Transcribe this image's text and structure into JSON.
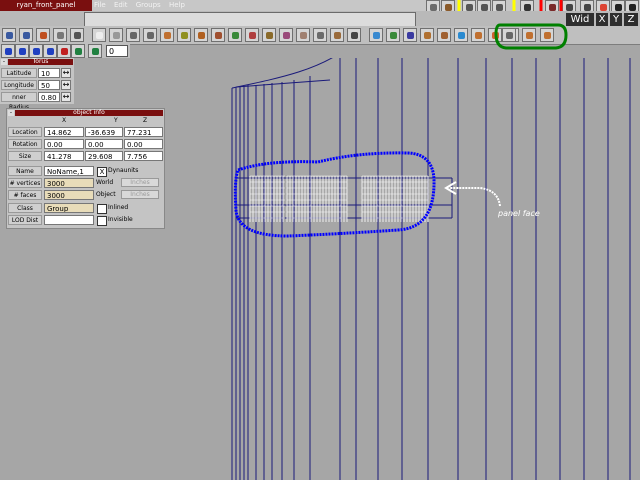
{
  "window": {
    "title": "ryan_front_panel"
  },
  "menu": [
    "File",
    "Edit",
    "Groups",
    "Help"
  ],
  "view_controls": {
    "wid": "Wid",
    "x": "X",
    "y": "Y",
    "z": "Z"
  },
  "timeline": {
    "frame": "0"
  },
  "torus_panel": {
    "title": "Torus",
    "fields": [
      {
        "label": "Latitude",
        "value": "10"
      },
      {
        "label": "Longitude",
        "value": "50"
      },
      {
        "label": "nner Radius",
        "value": "0.80"
      }
    ]
  },
  "object_info": {
    "title": "object info",
    "headers": [
      "X",
      "Y",
      "Z"
    ],
    "rows": [
      {
        "label": "Location",
        "values": [
          "14.862",
          "-36.639",
          "77.231"
        ]
      },
      {
        "label": "Rotation",
        "values": [
          "0.00",
          "0.00",
          "0.00"
        ]
      },
      {
        "label": "Size",
        "values": [
          "41.278",
          "29.608",
          "7.756"
        ]
      }
    ],
    "name_label": "Name",
    "name_value": "NoName,1",
    "dynaunits_label": "Dynaunits",
    "vertices_label": "# vertices",
    "vertices_value": "3000",
    "faces_label": "# faces",
    "faces_value": "3000",
    "world_label": "World",
    "object_label": "Object",
    "inches_label": "Inches",
    "class_label": "Class",
    "class_value": "Group",
    "inlined_label": "Inlined",
    "invisible_label": "Invisible",
    "lod_label": "LOD Dist",
    "lod_value": ""
  },
  "annotation": {
    "text": "panel face"
  },
  "colors": {
    "title_red": "#7a0f0f",
    "viewport_bg": "#a6a6a6",
    "highlight_yellow": "#ffff00",
    "highlight_red": "#ff0000",
    "highlight_green": "#008000",
    "highlight_blue": "#0000ff",
    "wire": "#1a1a7a"
  }
}
